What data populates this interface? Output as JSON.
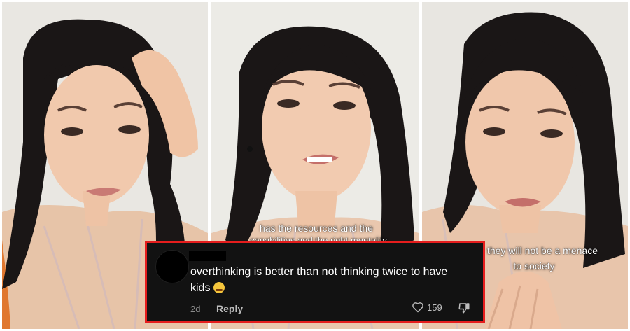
{
  "captions": {
    "panel2_line1": "has the resources and the",
    "panel2_line2": "capabilities and the right mentality",
    "panel3_line1": "they will not be a menace",
    "panel3_line2": "to society"
  },
  "comment": {
    "text": "overthinking is better than not thinking twice to have kids",
    "age": "2d",
    "reply_label": "Reply",
    "like_count": "159",
    "border_color": "#e51d1d"
  }
}
